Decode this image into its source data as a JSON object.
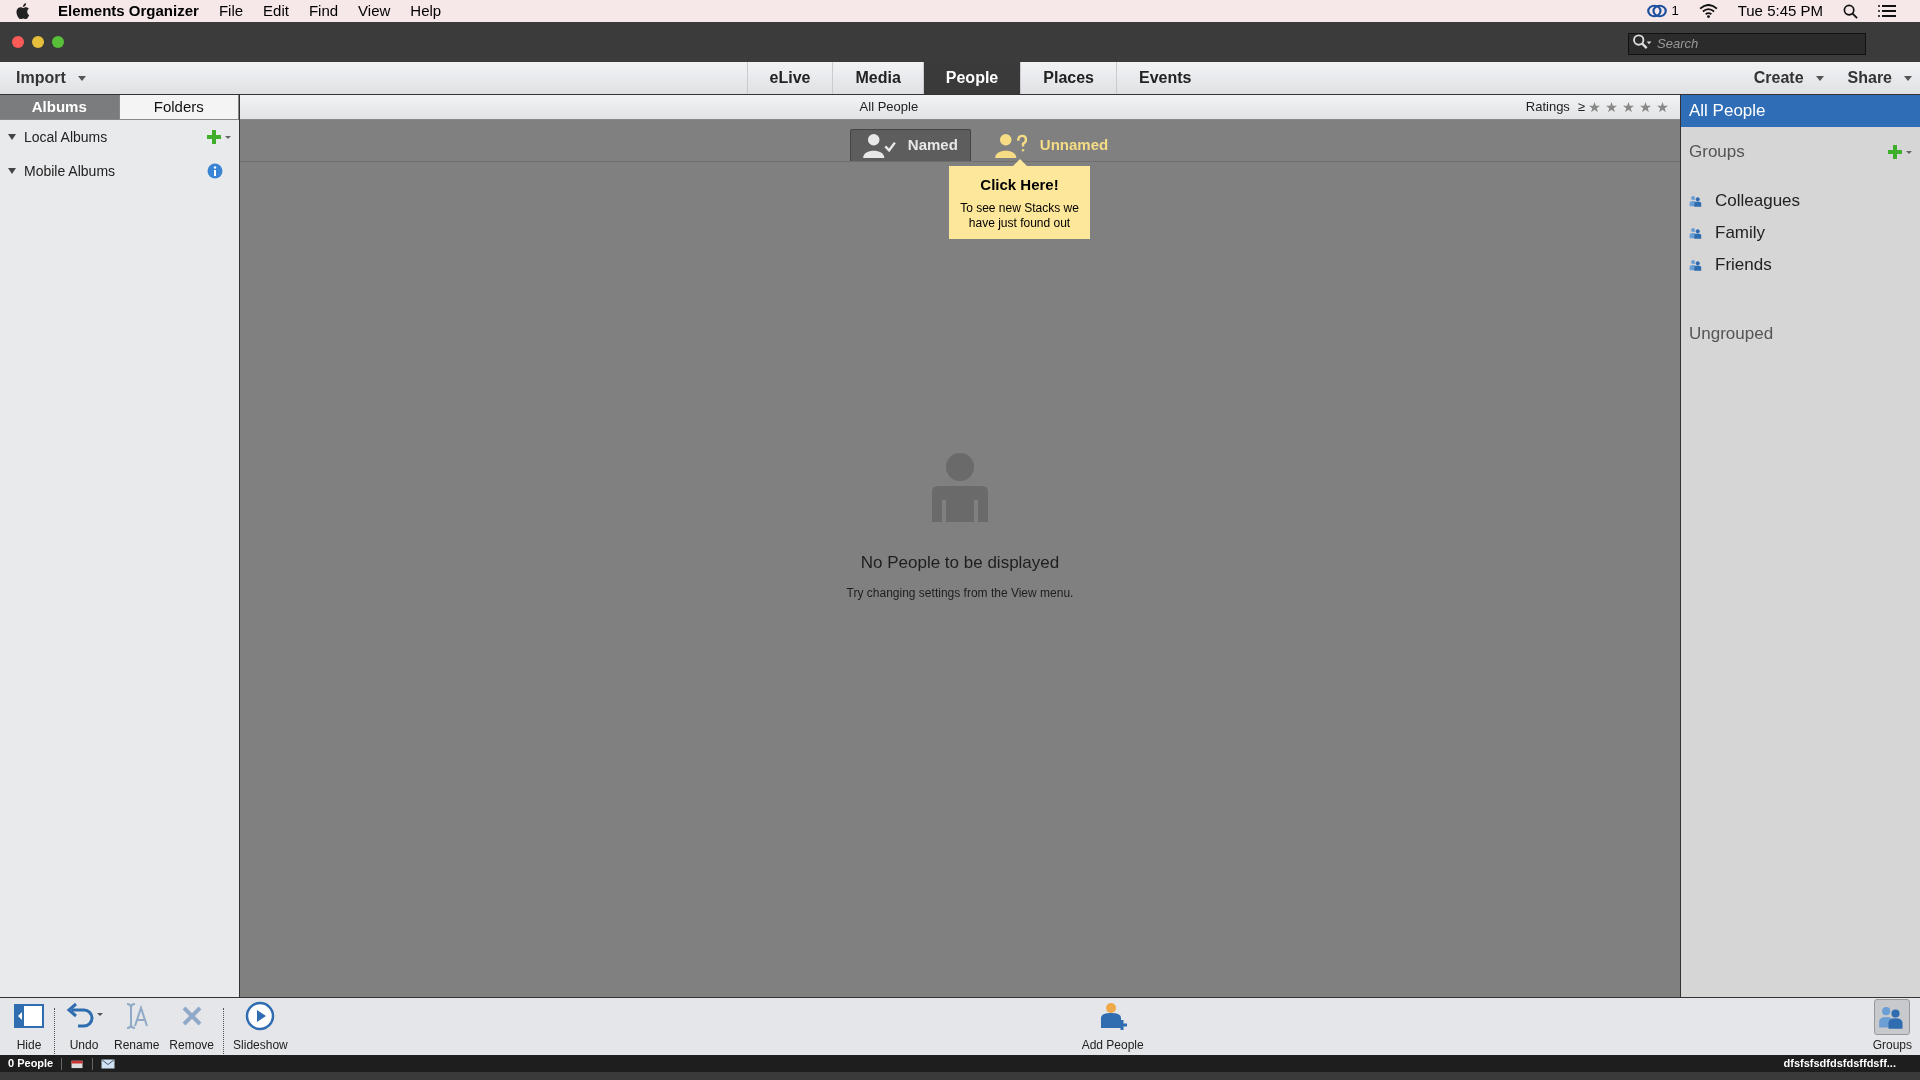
{
  "menu_bar": {
    "app_name": "Elements Organizer",
    "items": [
      "File",
      "Edit",
      "Find",
      "View",
      "Help"
    ],
    "cloud_count": "1",
    "clock": "Tue 5:45 PM"
  },
  "title_bar": {
    "search": {
      "placeholder": "Search"
    }
  },
  "top_bar": {
    "import": "Import",
    "tabs": [
      {
        "label": "eLive",
        "selected": false
      },
      {
        "label": "Media",
        "selected": false
      },
      {
        "label": "People",
        "selected": true
      },
      {
        "label": "Places",
        "selected": false
      },
      {
        "label": "Events",
        "selected": false
      }
    ],
    "actions": [
      "Create",
      "Share"
    ]
  },
  "left_panel": {
    "tabs": [
      {
        "label": "Albums",
        "selected": true
      },
      {
        "label": "Folders",
        "selected": false
      }
    ],
    "sections": [
      {
        "label": "Local Albums",
        "kind": "add",
        "expanded": true
      },
      {
        "label": "Mobile Albums",
        "kind": "info",
        "expanded": true
      }
    ]
  },
  "main": {
    "heading": "All People",
    "ratings_label": "Ratings",
    "ratings_op": "≥",
    "filters": [
      {
        "label": "Named",
        "kind": "named",
        "selected": true
      },
      {
        "label": "Unnamed",
        "kind": "unnamed",
        "selected": false
      }
    ],
    "tooltip": {
      "title": "Click Here!",
      "text": "To see new Stacks we have just found out"
    },
    "empty_title": "No People to be displayed",
    "empty_hint": "Try changing settings from the View menu."
  },
  "right_panel": {
    "all": {
      "label": "All People",
      "selected": true
    },
    "groups_label": "Groups",
    "groups": [
      {
        "label": "Colleagues",
        "selected": false
      },
      {
        "label": "Family",
        "selected": false
      },
      {
        "label": "Friends",
        "selected": false
      }
    ],
    "ungrouped": "Ungrouped"
  },
  "toolbar": {
    "left": [
      {
        "label": "Hide",
        "kind": "hide"
      },
      {
        "label": "Undo",
        "kind": "undo"
      },
      {
        "label": "Rename",
        "kind": "rename"
      },
      {
        "label": "Remove",
        "kind": "remove"
      },
      {
        "label": "Slideshow",
        "kind": "slideshow"
      }
    ],
    "center": {
      "label": "Add People"
    },
    "right": {
      "label": "Groups"
    }
  },
  "status_bar": {
    "count": "0 People",
    "right": "dfsfsfsdfdsfdsffdsff..."
  }
}
